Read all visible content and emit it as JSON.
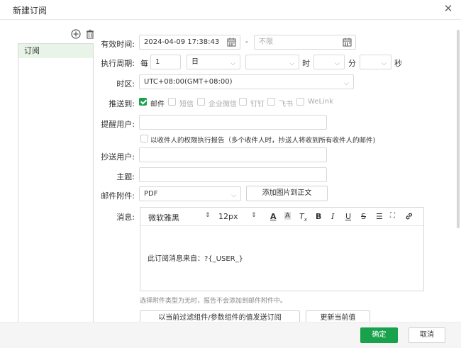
{
  "dialog": {
    "title": "新建订阅"
  },
  "sidebar": {
    "items": [
      {
        "label": "订阅"
      }
    ]
  },
  "form": {
    "valid_time": {
      "label": "有效时间:",
      "start": "2024-04-09 17:38:43",
      "separator": "-",
      "end_placeholder": "不限"
    },
    "period": {
      "label": "执行周期:",
      "every": "每",
      "count": "1",
      "unit": "日",
      "hour_suffix": "时",
      "minute_suffix": "分",
      "second_suffix": "秒"
    },
    "timezone": {
      "label": "时区:",
      "value": "UTC+08:00(GMT+08:00)"
    },
    "push_to": {
      "label": "推送到:",
      "options": [
        {
          "label": "邮件",
          "checked": true
        },
        {
          "label": "短信",
          "checked": false
        },
        {
          "label": "企业微信",
          "checked": false
        },
        {
          "label": "钉钉",
          "checked": false
        },
        {
          "label": "飞书",
          "checked": false
        },
        {
          "label": "WeLink",
          "checked": false
        }
      ]
    },
    "remind_user": {
      "label": "提醒用户:"
    },
    "permission_report": {
      "label": "以收件人的权限执行报告（多个收件人时，抄送人将收到所有收件人的邮件)"
    },
    "cc_user": {
      "label": "抄送用户:"
    },
    "subject": {
      "label": "主题:"
    },
    "attachment": {
      "label": "邮件附件:",
      "value": "PDF",
      "add_image_button": "添加图片到正文"
    },
    "message": {
      "label": "消息:",
      "font": "微软雅黑",
      "size": "12px",
      "body": "此订阅消息来自：?{_USER_}"
    },
    "hint": "选择附件类型为无时，报告不会添加到邮件附件中。",
    "send_by_filter_button": "以当前过滤组件/参数组件的值发送订阅",
    "update_value_button": "更新当前值"
  },
  "footer": {
    "ok": "确定",
    "cancel": "取消"
  },
  "colors": {
    "accent": "#1aa14c",
    "selected_bg": "#e9f4e9"
  }
}
